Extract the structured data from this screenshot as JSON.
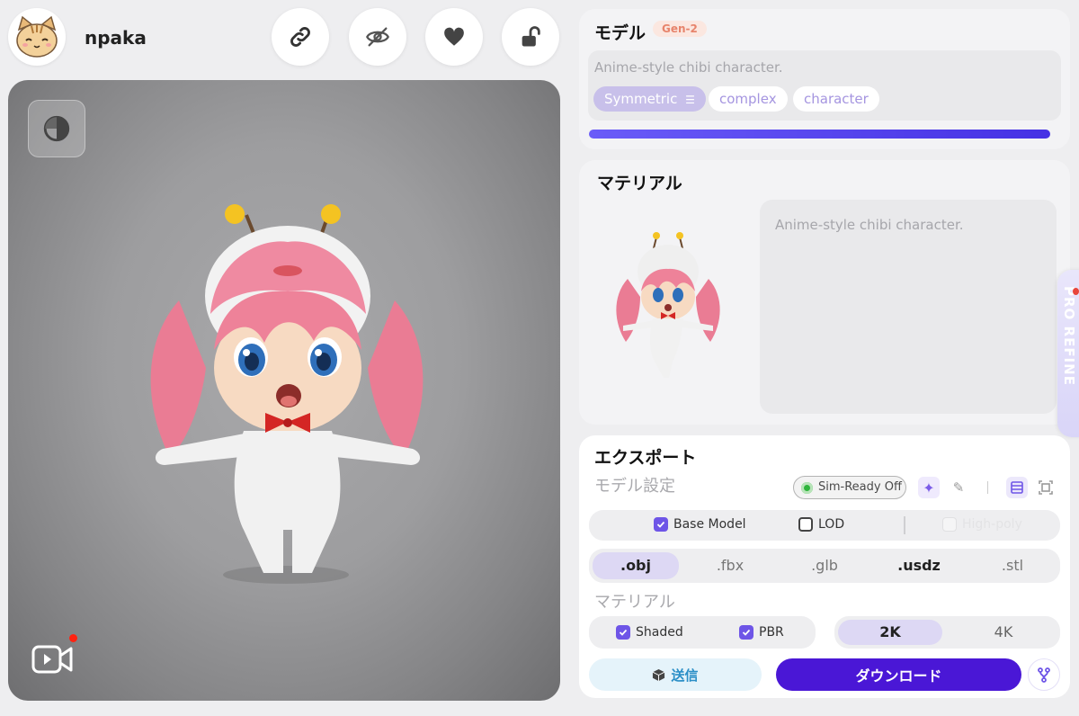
{
  "header": {
    "username": "npaka",
    "buttons": [
      {
        "name": "link",
        "icon": "link-icon"
      },
      {
        "name": "visibility",
        "icon": "eye-off-icon"
      },
      {
        "name": "like",
        "icon": "heart-icon"
      },
      {
        "name": "lock",
        "icon": "unlock-icon"
      }
    ]
  },
  "model": {
    "title": "モデル",
    "badge": "Gen-2",
    "prompt": "Anime-style chibi character.",
    "tags": [
      {
        "label": "Symmetric",
        "active": true
      },
      {
        "label": "complex",
        "active": false
      },
      {
        "label": "character",
        "active": false
      }
    ],
    "progress": 1.0
  },
  "material": {
    "title": "マテリアル",
    "prompt": "Anime-style chibi character."
  },
  "side_tab": {
    "label": "PRO REFINE"
  },
  "export": {
    "title": "エクスポート",
    "model_settings_label": "モデル設定",
    "sim_ready_label": "Sim-Ready Off",
    "options": [
      {
        "label": "Base Model",
        "checked": true
      },
      {
        "label": "LOD",
        "checked": false
      },
      {
        "label": "High-poly",
        "checked": false,
        "disabled": true
      }
    ],
    "formats": [
      ".obj",
      ".fbx",
      ".glb",
      ".usdz",
      ".stl"
    ],
    "selected_format": ".obj",
    "material_label": "マテリアル",
    "material_options": [
      {
        "label": "Shaded",
        "checked": true
      },
      {
        "label": "PBR",
        "checked": true
      }
    ],
    "resolutions": [
      "2K",
      "4K"
    ],
    "selected_resolution": "2K",
    "send_label": "送信",
    "download_label": "ダウンロード"
  },
  "colors": {
    "accent": "#4a17d6",
    "progress": "#5240ec",
    "tag_active": "#c8c0ea",
    "selected_bg": "#ddd8f4",
    "send_text": "#2b8fc7",
    "badge_text": "#e7846c"
  }
}
